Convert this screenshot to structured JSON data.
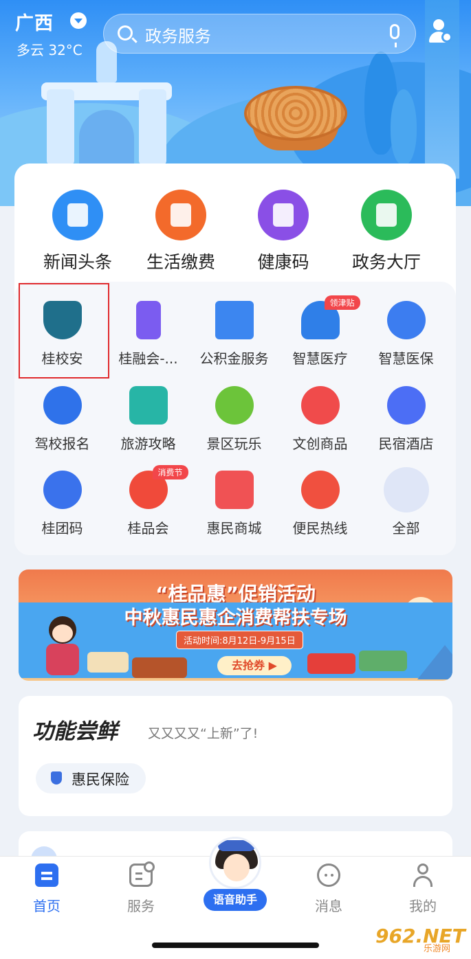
{
  "header": {
    "city": "广西",
    "weather": "多云 32°C",
    "search_placeholder": "政务服务"
  },
  "top_services": [
    {
      "label": "新闻头条",
      "icon": "news-icon",
      "color": "#2f8ff5"
    },
    {
      "label": "生活缴费",
      "icon": "payment-icon",
      "color": "#f36a2b"
    },
    {
      "label": "健康码",
      "icon": "qr-code-icon",
      "color": "#8a4fe6"
    },
    {
      "label": "政务大厅",
      "icon": "government-hall-icon",
      "color": "#2bbb5a"
    }
  ],
  "grid_services": [
    {
      "label": "桂校安",
      "icon": "shield-icon",
      "color": "#1f6f8b",
      "badge": ""
    },
    {
      "label": "桂融会-...",
      "icon": "phone-video-icon",
      "color": "#7b5cf0",
      "badge": ""
    },
    {
      "label": "公积金服务",
      "icon": "house-fund-icon",
      "color": "#3c86f0",
      "badge": ""
    },
    {
      "label": "智慧医疗",
      "icon": "doctor-icon",
      "color": "#2f7fe8",
      "badge": "领津贴"
    },
    {
      "label": "智慧医保",
      "icon": "heart-hands-icon",
      "color": "#3c7df0",
      "badge": ""
    },
    {
      "label": "驾校报名",
      "icon": "steering-wheel-icon",
      "color": "#2f72ea",
      "badge": ""
    },
    {
      "label": "旅游攻略",
      "icon": "travel-guide-icon",
      "color": "#27b5a6",
      "badge": ""
    },
    {
      "label": "景区玩乐",
      "icon": "scenery-icon",
      "color": "#6cc43a",
      "badge": ""
    },
    {
      "label": "文创商品",
      "icon": "gift-icon",
      "color": "#f04b4b",
      "badge": ""
    },
    {
      "label": "民宿酒店",
      "icon": "hotel-icon",
      "color": "#4c6ef5",
      "badge": ""
    },
    {
      "label": "桂团码",
      "icon": "group-code-icon",
      "color": "#3a72ec",
      "badge": ""
    },
    {
      "label": "桂品会",
      "icon": "guipinhui-icon",
      "color": "#f04a3a",
      "badge": "消费节"
    },
    {
      "label": "惠民商城",
      "icon": "shopping-bag-icon",
      "color": "#f05254",
      "badge": ""
    },
    {
      "label": "便民热线",
      "icon": "phone-icon",
      "color": "#f0503f",
      "badge": ""
    },
    {
      "label": "全部",
      "icon": "all-apps-icon",
      "color": "#8fa5e6",
      "badge": ""
    }
  ],
  "banner": {
    "title": "“桂品惠”促销活动",
    "subtitle": "中秋惠民惠企消费帮扶专场",
    "date": "活动时间:8月12日-9月15日",
    "cta": "去抢券 ▶"
  },
  "features": {
    "title": "功能尝鲜",
    "subtitle": "又又又又“上新”了!",
    "chip_label": "惠民保险"
  },
  "voice_label": "语音助手",
  "nav": [
    {
      "label": "首页",
      "active": true
    },
    {
      "label": "服务",
      "active": false
    },
    {
      "label": "消息",
      "active": false
    },
    {
      "label": "我的",
      "active": false
    }
  ],
  "watermark": {
    "number": "962",
    "suffix": ".NET",
    "text": "乐游网"
  }
}
